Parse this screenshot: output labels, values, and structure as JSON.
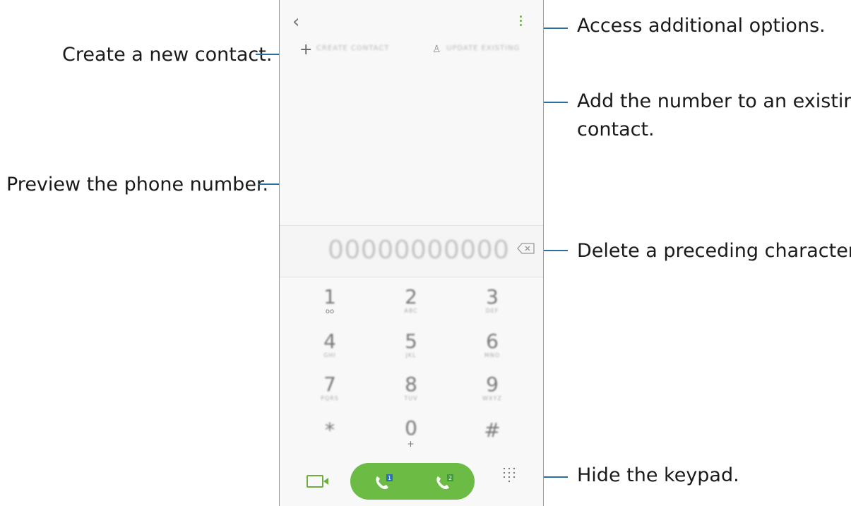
{
  "callouts": {
    "options": "Access additional options.",
    "create_contact": "Create a new contact.",
    "add_existing_line1": "Add the number to an existing",
    "add_existing_line2": "contact.",
    "preview_number": "Preview the phone number.",
    "delete_char": "Delete a preceding character.",
    "hide_keypad": "Hide the keypad."
  },
  "phone": {
    "back_glyph": "‹",
    "create_contact_label": "CREATE CONTACT",
    "update_existing_label": "UPDATE EXISTING",
    "number_display": "00000000000",
    "keys": [
      {
        "digit": "1",
        "sub": ""
      },
      {
        "digit": "2",
        "sub": "ABC"
      },
      {
        "digit": "3",
        "sub": "DEF"
      },
      {
        "digit": "4",
        "sub": "GHI"
      },
      {
        "digit": "5",
        "sub": "JKL"
      },
      {
        "digit": "6",
        "sub": "MNO"
      },
      {
        "digit": "7",
        "sub": "PQRS"
      },
      {
        "digit": "8",
        "sub": "TUV"
      },
      {
        "digit": "9",
        "sub": "WXYZ"
      },
      {
        "digit": "*",
        "sub": ""
      },
      {
        "digit": "0",
        "sub": "+"
      },
      {
        "digit": "#",
        "sub": ""
      }
    ],
    "sim1": "1",
    "sim2": "2",
    "colors": {
      "accent": "#6bbb45",
      "callout_line": "#2a6f9e"
    }
  }
}
